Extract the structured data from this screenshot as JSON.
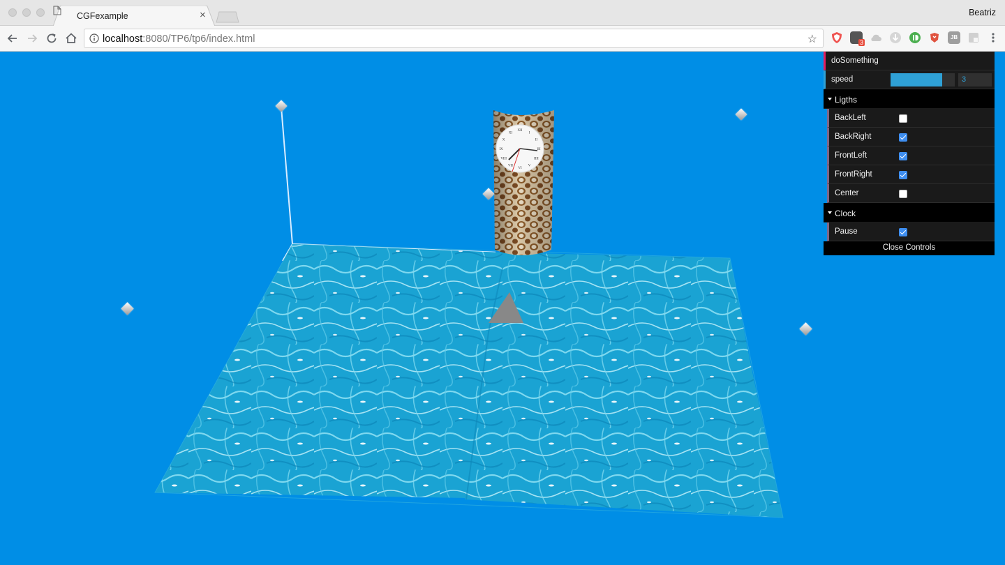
{
  "browser": {
    "tab_title": "CGFexample",
    "profile_name": "Beatriz",
    "url_host": "localhost",
    "url_path": ":8080/TP6/tp6/index.html",
    "extension_badge": "3"
  },
  "gui": {
    "do_something_label": "doSomething",
    "speed": {
      "label": "speed",
      "value": "3",
      "fill_fraction": 0.8
    },
    "lights_folder": {
      "title": "Ligths",
      "items": [
        {
          "label": "BackLeft",
          "checked": false
        },
        {
          "label": "BackRight",
          "checked": true
        },
        {
          "label": "FrontLeft",
          "checked": true
        },
        {
          "label": "FrontRight",
          "checked": true
        },
        {
          "label": "Center",
          "checked": false
        }
      ]
    },
    "clock_folder": {
      "title": "Clock",
      "items": [
        {
          "label": "Pause",
          "checked": true
        }
      ]
    },
    "close_label": "Close Controls"
  },
  "scene": {
    "background_color": "#008ee6",
    "water_color": "#1fa8d4",
    "clock_roman_numerals": [
      "XII",
      "I",
      "II",
      "III",
      "IIII",
      "V",
      "VI",
      "VII",
      "VIII",
      "IX",
      "X",
      "XI"
    ]
  }
}
